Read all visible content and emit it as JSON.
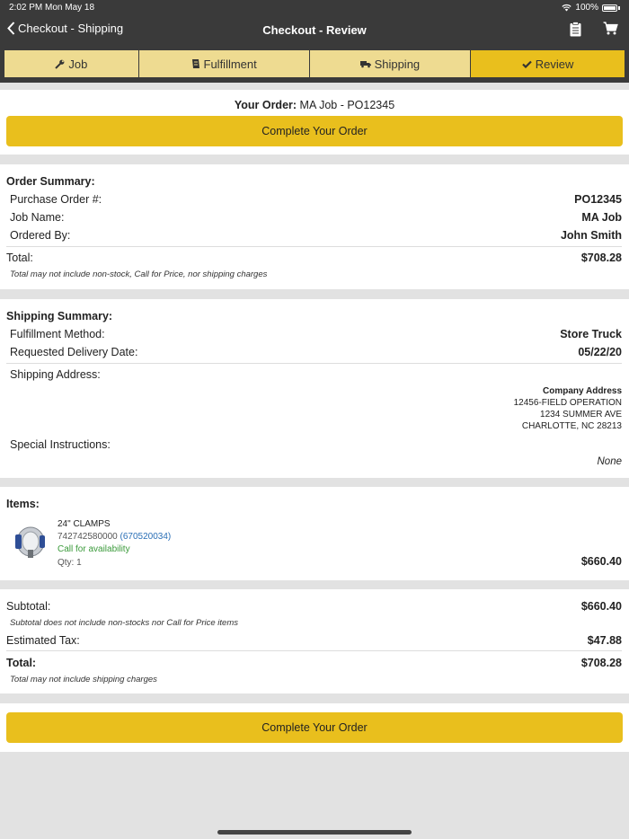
{
  "status": {
    "time_date": "2:02 PM   Mon May 18",
    "battery": "100%"
  },
  "nav": {
    "back_label": "Checkout - Shipping",
    "title": "Checkout - Review"
  },
  "steps": [
    {
      "label": "Job",
      "icon": "wrench-icon"
    },
    {
      "label": "Fulfillment",
      "icon": "truck-box-icon"
    },
    {
      "label": "Shipping",
      "icon": "truck-icon"
    },
    {
      "label": "Review",
      "icon": "checkmark-icon"
    }
  ],
  "order": {
    "your_order_label": "Your Order:",
    "your_order_value": "MA Job - PO12345",
    "complete_button": "Complete Your Order"
  },
  "order_summary": {
    "heading": "Order Summary:",
    "po_label": "Purchase Order #:",
    "po_value": "PO12345",
    "job_label": "Job Name:",
    "job_value": "MA Job",
    "ordered_label": "Ordered By:",
    "ordered_value": "John Smith",
    "total_label": "Total:",
    "total_value": "$708.28",
    "note": "Total may not include non-stock, Call for Price, nor shipping charges"
  },
  "shipping_summary": {
    "heading": "Shipping Summary:",
    "method_label": "Fulfillment Method:",
    "method_value": "Store Truck",
    "date_label": "Requested Delivery Date:",
    "date_value": "05/22/20",
    "address_label": "Shipping Address:",
    "address": [
      "Company Address",
      "12456-FIELD OPERATION",
      "1234 SUMMER AVE",
      "CHARLOTTE, NC 28213"
    ],
    "instructions_label": "Special Instructions:",
    "instructions_value": "None"
  },
  "items": {
    "heading": "Items:",
    "list": [
      {
        "name": "24\" CLAMPS",
        "sku": "742742580000",
        "alt_id": "(670520034)",
        "availability": "Call for availability",
        "qty": "Qty: 1",
        "price": "$660.40"
      }
    ]
  },
  "totals": {
    "subtotal_label": "Subtotal:",
    "subtotal_value": "$660.40",
    "subtotal_note": "Subtotal does not include non-stocks nor Call for Price items",
    "tax_label": "Estimated Tax:",
    "tax_value": "$47.88",
    "total_label": "Total:",
    "total_value": "$708.28",
    "total_note": "Total may not include shipping charges"
  },
  "bottom": {
    "complete_button": "Complete Your Order"
  },
  "colors": {
    "accent": "#e9bf1d",
    "accent_light": "#eedb91",
    "header": "#3a3a3a",
    "link": "#2a6fb6",
    "available": "#3a9a3a"
  }
}
